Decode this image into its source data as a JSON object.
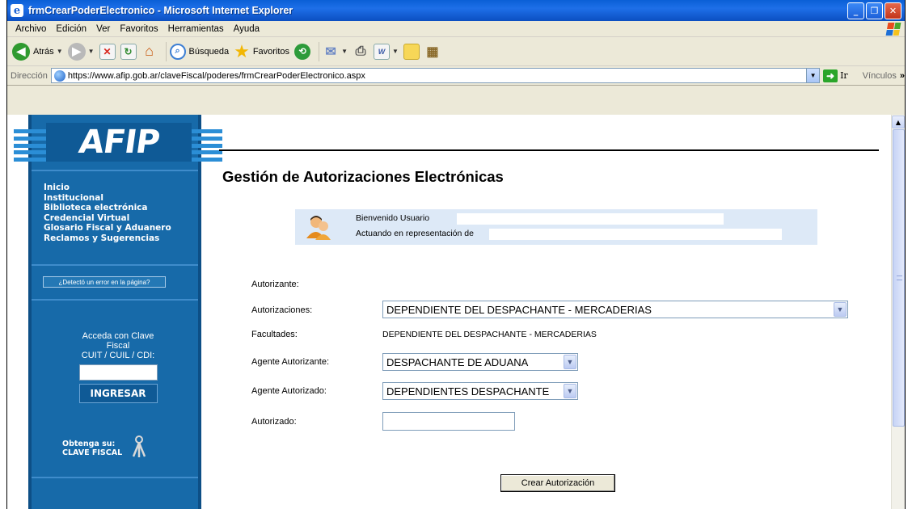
{
  "window": {
    "title": "frmCrearPoderElectronico - Microsoft Internet Explorer"
  },
  "menu": [
    "Archivo",
    "Edición",
    "Ver",
    "Favoritos",
    "Herramientas",
    "Ayuda"
  ],
  "toolbar": {
    "back_label": "Atrás",
    "search_label": "Búsqueda",
    "favorites_label": "Favoritos"
  },
  "address": {
    "label": "Dirección",
    "url": "https://www.afip.gob.ar/claveFiscal/poderes/frmCrearPoderElectronico.aspx",
    "go_label": "Ir",
    "links_label": "Vínculos"
  },
  "sidebar": {
    "logo": "AFIP",
    "nav": [
      "Inicio",
      "Institucional",
      "Biblioteca electrónica",
      "Credencial Virtual",
      "Glosario Fiscal y Aduanero",
      "Reclamos y Sugerencias"
    ],
    "error_button": "¿Detectó un error en la página?",
    "login_line1": "Acceda con Clave",
    "login_line2": "Fiscal",
    "login_line3": "CUIT / CUIL / CDI:",
    "ingresar_label": "INGRESAR",
    "obtenga_line1": "Obtenga su:",
    "obtenga_line2": "CLAVE FISCAL"
  },
  "page": {
    "title": "Gestión de Autorizaciones Electrónicas",
    "welcome_user": "Bienvenido Usuario",
    "acting_for": "Actuando en representación de"
  },
  "form": {
    "autorizante_label": "Autorizante:",
    "autorizaciones_label": "Autorizaciones:",
    "autorizaciones_value": "DEPENDIENTE DEL DESPACHANTE - MERCADERIAS",
    "facultades_label": "Facultades:",
    "facultades_value": "DEPENDIENTE DEL DESPACHANTE - MERCADERIAS",
    "agente_autorizante_label": "Agente Autorizante:",
    "agente_autorizante_value": "DESPACHANTE DE ADUANA",
    "agente_autorizado_label": "Agente Autorizado:",
    "agente_autorizado_value": "DEPENDIENTES DESPACHANTE",
    "autorizado_label": "Autorizado:",
    "autorizado_value": "",
    "submit_label": "Crear Autorización"
  },
  "colors": {
    "afip_blue": "#176aa9",
    "welcome_bg": "#dde9f7",
    "titlebar": "#0a5fd6"
  }
}
